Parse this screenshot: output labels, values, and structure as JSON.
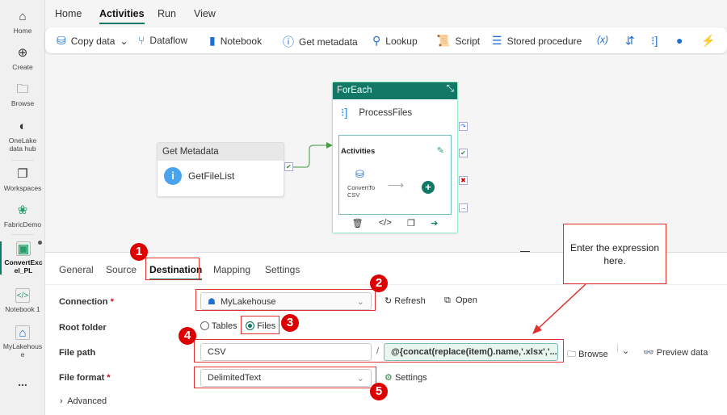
{
  "sidebar": {
    "items": [
      {
        "label": "Home",
        "icon": "home-icon"
      },
      {
        "label": "Create",
        "icon": "plus-circle-icon"
      },
      {
        "label": "Browse",
        "icon": "folder-icon"
      },
      {
        "label": "OneLake data hub",
        "icon": "onelake-icon"
      },
      {
        "label": "Workspaces",
        "icon": "workspaces-icon"
      },
      {
        "label": "FabricDemo",
        "icon": "people-icon"
      },
      {
        "label": "ConvertExcel_PL",
        "icon": "pipeline-icon",
        "active": true
      },
      {
        "label": "Notebook 1",
        "icon": "notebook-icon"
      },
      {
        "label": "MyLakehouse",
        "icon": "lakehouse-icon"
      }
    ],
    "more": "..."
  },
  "topnav": {
    "tabs": [
      "Home",
      "Activities",
      "Run",
      "View"
    ],
    "active": "Activities"
  },
  "toolbar": {
    "items": [
      "Copy data",
      "Dataflow",
      "Notebook",
      "Get metadata",
      "Lookup",
      "Script",
      "Stored procedure"
    ],
    "expression_icon": "(x)"
  },
  "canvas": {
    "get_metadata": {
      "header": "Get Metadata",
      "name": "GetFileList"
    },
    "foreach": {
      "header": "ForEach",
      "name": "ProcessFiles",
      "activities_label": "Activities",
      "inner_activity": "ConvertTo CSV"
    }
  },
  "panel": {
    "tabs": [
      "General",
      "Source",
      "Destination",
      "Mapping",
      "Settings"
    ],
    "active": "Destination",
    "connection": {
      "label": "Connection",
      "value": "MyLakehouse",
      "refresh": "Refresh",
      "open": "Open"
    },
    "root_folder": {
      "label": "Root folder",
      "options": [
        "Tables",
        "Files"
      ],
      "selected": "Files"
    },
    "file_path": {
      "label": "File path",
      "folder": "CSV",
      "separator": "/",
      "file": "@{concat(replace(item().name,'.xlsx','...",
      "browse": "Browse",
      "preview": "Preview data"
    },
    "file_format": {
      "label": "File format",
      "value": "DelimitedText",
      "settings": "Settings"
    },
    "advanced": "Advanced"
  },
  "annotations": {
    "badges": [
      "1",
      "2",
      "3",
      "4",
      "5"
    ],
    "callout": "Enter the expression here.",
    "color": "#e03030"
  },
  "colors": {
    "accent": "#117865"
  }
}
